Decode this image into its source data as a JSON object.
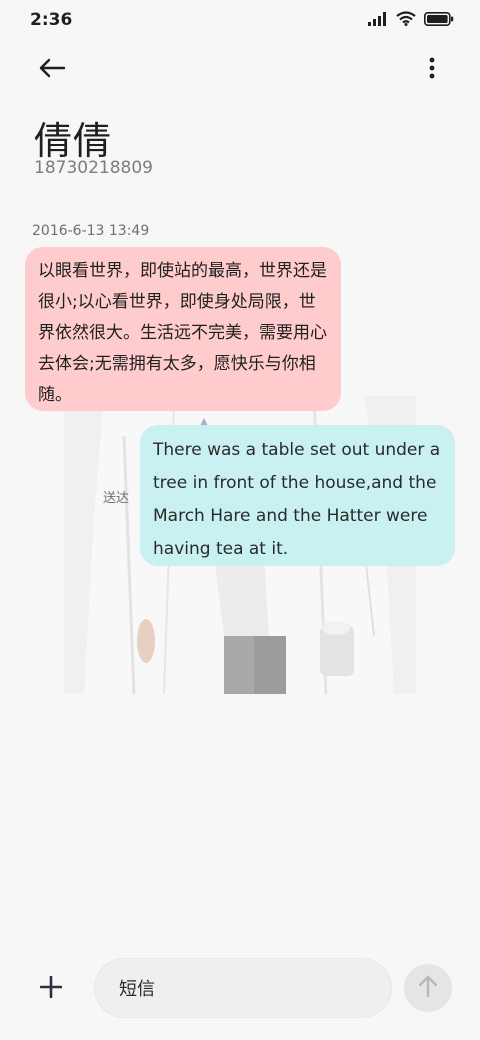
{
  "status_bar": {
    "time": "2:36",
    "icons": [
      "signal-icon",
      "wifi-icon",
      "battery-icon"
    ]
  },
  "header": {
    "back_icon": "arrow-left-icon",
    "more_icon": "vertical-dots-icon",
    "contact_name": "倩倩",
    "contact_number": "18730218809"
  },
  "conversation": {
    "timestamp": "2016-6-13 13:49",
    "incoming": {
      "text": "以眼看世界，即使站的最高，世界还是很小;以心看世界，即使身处局限，世界依然很大。生活远不完美，需要用心去体会;无需拥有太多，愿快乐与你相随。",
      "color": "#ffcccd"
    },
    "outgoing": {
      "text": "There was a table set out under a tree in front of the house,and the March Hare and the Hatter were having tea at it.",
      "status": "送达",
      "color": "#c9f1f2"
    }
  },
  "composer": {
    "plus_icon": "plus-icon",
    "input_value": "短信",
    "send_icon": "arrow-up-icon"
  }
}
